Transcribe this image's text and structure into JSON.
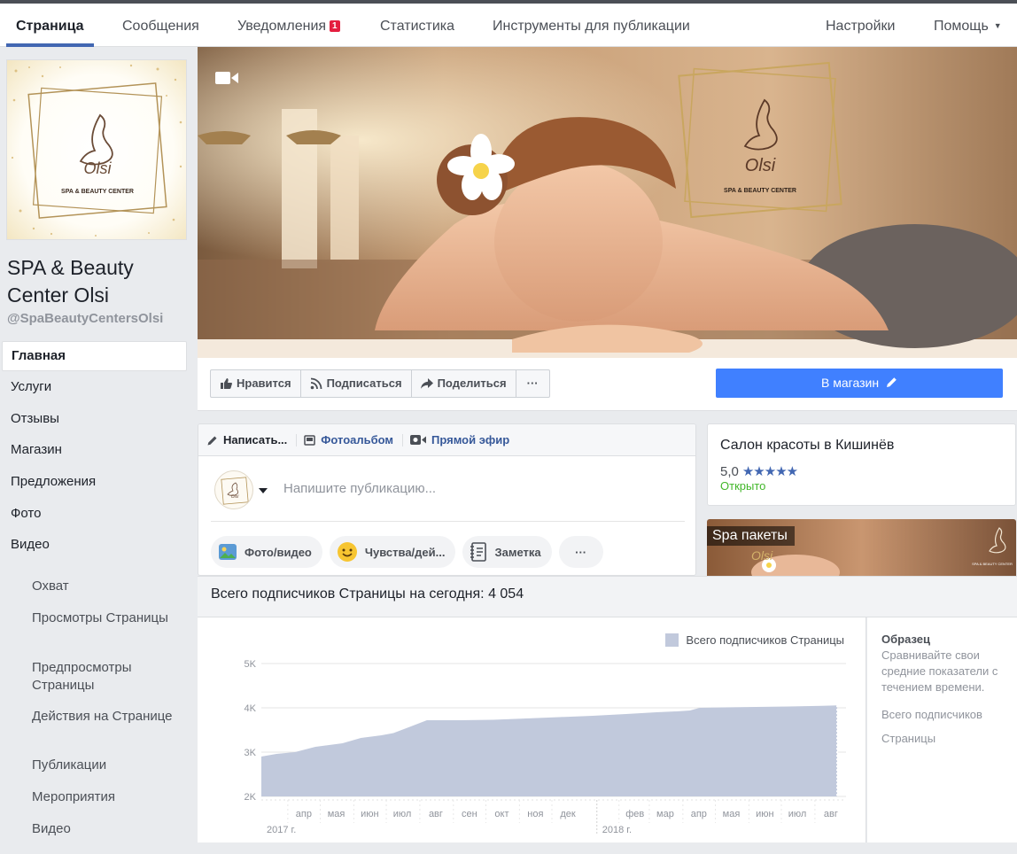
{
  "nav": {
    "tabs": [
      {
        "label": "Страница"
      },
      {
        "label": "Сообщения"
      },
      {
        "label": "Уведомления"
      },
      {
        "label": "Статистика"
      },
      {
        "label": "Инструменты для публикации"
      }
    ],
    "notifications_badge": "1",
    "settings": "Настройки",
    "help": "Помощь"
  },
  "page": {
    "name": "SPA & Beauty Center Olsi",
    "handle": "@SpaBeautyCentersOlsi",
    "logo_text": "SPA & BEAUTY CENTER",
    "logo_script": "Olsi"
  },
  "sidebar": {
    "items": [
      {
        "label": "Главная"
      },
      {
        "label": "Услуги"
      },
      {
        "label": "Отзывы"
      },
      {
        "label": "Магазин"
      },
      {
        "label": "Предложения"
      },
      {
        "label": "Фото"
      },
      {
        "label": "Видео"
      }
    ],
    "stats": [
      {
        "label": "Охват"
      },
      {
        "label": "Просмотры Страницы"
      },
      {
        "label": "Предпросмотры Страницы"
      },
      {
        "label": "Действия на Странице"
      },
      {
        "label": "Публикации"
      },
      {
        "label": "Мероприятия"
      },
      {
        "label": "Видео"
      }
    ]
  },
  "actions": {
    "like": "Нравится",
    "follow": "Подписаться",
    "share": "Поделиться",
    "more": "···",
    "shop": "В магазин"
  },
  "composer": {
    "tabs": [
      {
        "label": "Написать..."
      },
      {
        "label": "Фотоальбом"
      },
      {
        "label": "Прямой эфир"
      }
    ],
    "placeholder": "Напишите публикацию...",
    "buttons": [
      {
        "label": "Фото/видео"
      },
      {
        "label": "Чувства/дей..."
      },
      {
        "label": "Заметка"
      }
    ],
    "more": "···"
  },
  "info": {
    "title": "Салон красоты в Кишинёв",
    "rating": "5,0",
    "stars": "★★★★★",
    "status": "Открыто"
  },
  "spa_card": {
    "label": "Spa пакеты"
  },
  "followers": {
    "title": "Всего подписчиков Страницы на сегодня: 4 054",
    "sidebar_title": "Образец",
    "sidebar_text": "Сравнивайте свои средние показатели с течением времени.",
    "sidebar_metric_1": "Всего подписчиков",
    "sidebar_metric_2": "Страницы"
  },
  "colors": {
    "brand_blue": "#4267b2",
    "shop_button": "#4080ff",
    "chart_fill": "#c1c9dc",
    "open_green": "#42b72a",
    "badge_red": "#e41e3f"
  },
  "chart_data": {
    "type": "area",
    "legend": [
      "Всего подписчиков Страницы"
    ],
    "y_ticks": [
      "2K",
      "3K",
      "4K",
      "5K"
    ],
    "ylim": [
      2000,
      5000
    ],
    "x_ticks": [
      "апр",
      "мая",
      "июн",
      "июл",
      "авг",
      "сен",
      "окт",
      "ноя",
      "дек",
      "фев",
      "мар",
      "апр",
      "мая",
      "июн",
      "июл",
      "авг"
    ],
    "year_labels": [
      "2017 г.",
      "2018 г."
    ],
    "series": [
      {
        "name": "Всего подписчиков Страницы",
        "x": [
          "2017-03-01",
          "2017-03-15",
          "2017-04-01",
          "2017-04-20",
          "2017-05-15",
          "2017-06-01",
          "2017-06-20",
          "2017-07-01",
          "2017-07-15",
          "2017-08-01",
          "2017-09-01",
          "2017-10-01",
          "2017-11-01",
          "2017-12-01",
          "2018-01-01",
          "2018-02-01",
          "2018-03-01",
          "2018-03-20",
          "2018-04-01",
          "2018-04-10",
          "2018-05-01",
          "2018-06-01",
          "2018-07-01",
          "2018-08-01",
          "2018-08-15"
        ],
        "values": [
          2900,
          2960,
          3000,
          3120,
          3200,
          3320,
          3380,
          3430,
          3560,
          3720,
          3720,
          3730,
          3760,
          3790,
          3820,
          3860,
          3900,
          3920,
          3940,
          4000,
          4010,
          4020,
          4030,
          4045,
          4054
        ]
      }
    ]
  }
}
